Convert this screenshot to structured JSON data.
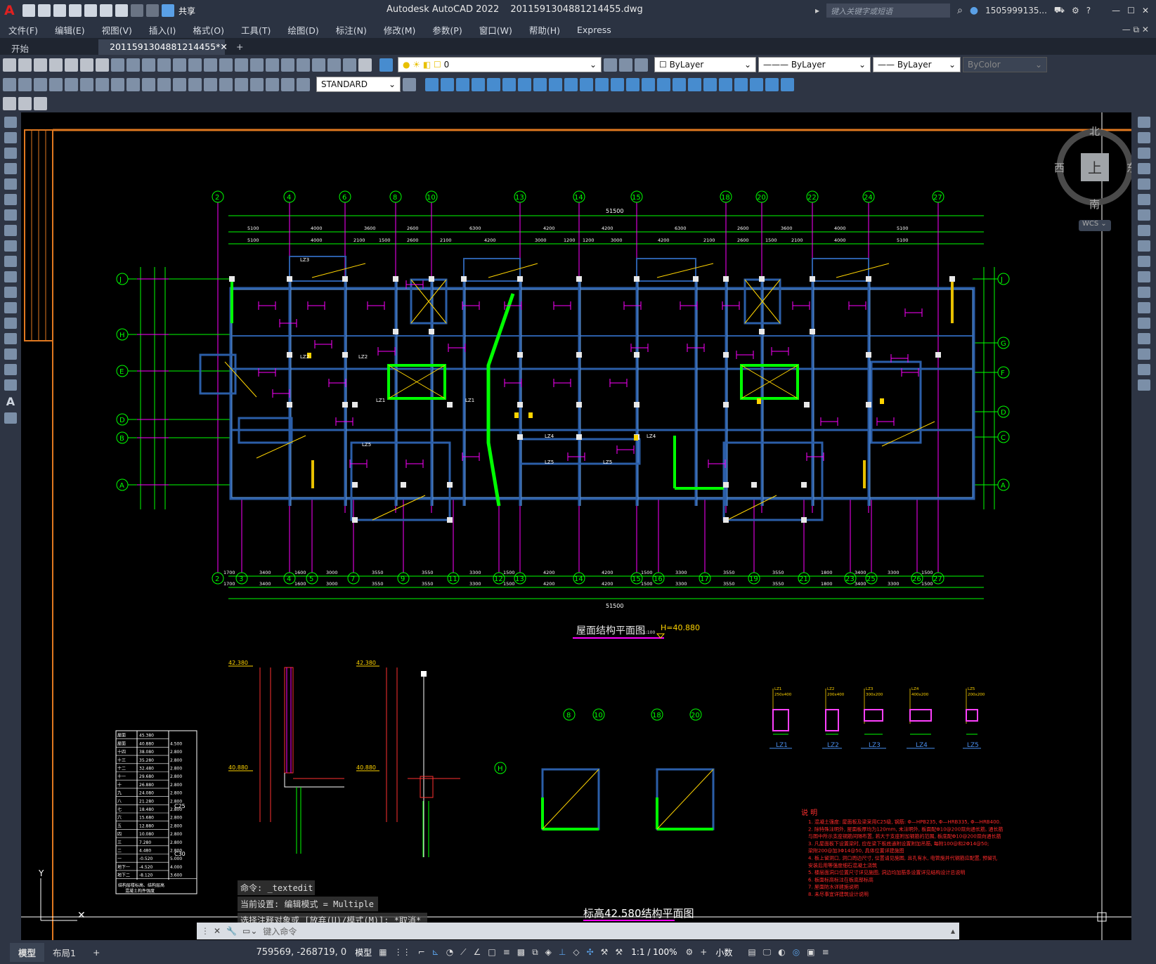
{
  "titlebar": {
    "app": "Autodesk AutoCAD 2022",
    "file": "2011591304881214455.dwg",
    "share": "共享",
    "search_placeholder": "键入关键字或短语",
    "user": "1505999135..."
  },
  "menu": [
    "文件(F)",
    "编辑(E)",
    "视图(V)",
    "插入(I)",
    "格式(O)",
    "工具(T)",
    "绘图(D)",
    "标注(N)",
    "修改(M)",
    "参数(P)",
    "窗口(W)",
    "帮助(H)",
    "Express"
  ],
  "tabs": {
    "start": "开始",
    "doc": "2011591304881214455*"
  },
  "toolbar": {
    "layer": "0",
    "color": "ByLayer",
    "linetype": "ByLayer",
    "lineweight": "ByLayer",
    "plotstyle": "ByColor",
    "textstyle": "STANDARD"
  },
  "navcube": {
    "north": "北",
    "south": "南",
    "east": "东",
    "west": "西",
    "top": "上",
    "wcs": "WCS"
  },
  "drawing": {
    "main_title": "屋面结构平面图",
    "main_scale": "1:100",
    "main_elev": "H=40.880",
    "sub_title": "标高42.580结构平面图",
    "total_dim": "51500",
    "top_axes": [
      "2",
      "4",
      "6",
      "8",
      "10",
      "13",
      "14",
      "15",
      "18",
      "20",
      "22",
      "24",
      "27"
    ],
    "bottom_axes": [
      "2",
      "3",
      "4",
      "5",
      "7",
      "9",
      "11",
      "12",
      "13",
      "14",
      "15",
      "16",
      "17",
      "19",
      "21",
      "23",
      "25",
      "26",
      "27"
    ],
    "left_axes": [
      "J",
      "H",
      "E",
      "D",
      "B",
      "A"
    ],
    "right_axes": [
      "J",
      "G",
      "F",
      "D",
      "C",
      "A"
    ],
    "top_dims": [
      "5100",
      "4000",
      "3600",
      "2600",
      "6300",
      "4200",
      "4200",
      "6300",
      "2600",
      "3600",
      "4000",
      "5100"
    ],
    "top_dims2": [
      "5100",
      "4000",
      "2100",
      "1500",
      "2600",
      "2100",
      "4200",
      "3000",
      "1200",
      "1200",
      "3000",
      "4200",
      "2100",
      "2600",
      "1500",
      "2100",
      "4000",
      "5100"
    ],
    "bottom_dims": [
      "1700",
      "3400",
      "1600",
      "3000",
      "3550",
      "3550",
      "3300",
      "1500",
      "4200",
      "4200",
      "1500",
      "3300",
      "3550",
      "3550",
      "1800",
      "3400",
      "3300",
      "1500"
    ],
    "col_labels": [
      "LZ1",
      "LZ2",
      "LZ3",
      "LZ4",
      "LZ5"
    ],
    "col_sizes": [
      "250x400",
      "200x400",
      "300x200",
      "400x200",
      "200x200"
    ],
    "elev1": "42.380",
    "elev2": "40.880",
    "notes_title": "说 明",
    "notes": [
      "1. 混凝土强度: 屋面板及梁采用C25级, 钢筋: Φ—HPB235, Φ—HRB335, Φ—HRB400.",
      "2. 除特殊注明外, 屋面板厚均为120mm, 未注明外, 板面配Φ10@200双向通长筋, 通长筋",
      "   与图中所示支座钢筋间隔布置, 若大于支座附加钢筋的范围, 板底配Φ10@200双向通长筋",
      "3. 凡屋面板下设置梁时, 应在梁下板底通附设置附加吊筋, 每附100@和2Φ14@50;",
      "   梁附200@加3Φ14@50, 具体位置详建施图",
      "4. 板上留洞口, 洞口周边尺寸, 位置请见施图, 且孔有水, 电管施并代钢筋应配置, 预留孔",
      "   安装后用等强度细石混凝土浇筑",
      "5. 楼层面洞口位置尺寸详见施图, 洞边均加筋条设置详见结构设计总说明",
      "6. 板面标高标注在板底部标高",
      "7. 屋面防水详建施说明",
      "8. 未尽事宜详建筑设计说明"
    ],
    "table_title": "结构层楼标高、结构层高",
    "table_sub": "混凝土构件强度",
    "table_rows": [
      [
        "屋面",
        "45.380",
        ""
      ],
      [
        "屋面",
        "40.880",
        "4.500"
      ],
      [
        "十四",
        "38.080",
        "2.800"
      ],
      [
        "十三",
        "35.280",
        "2.800"
      ],
      [
        "十二",
        "32.480",
        "2.800"
      ],
      [
        "十一",
        "29.680",
        "2.800"
      ],
      [
        "十",
        "26.880",
        "2.800"
      ],
      [
        "九",
        "24.080",
        "2.800"
      ],
      [
        "八",
        "21.280",
        "2.800"
      ],
      [
        "七",
        "18.480",
        "2.800"
      ],
      [
        "六",
        "15.680",
        "2.800"
      ],
      [
        "五",
        "12.880",
        "2.800"
      ],
      [
        "四",
        "10.080",
        "2.800"
      ],
      [
        "三",
        "7.280",
        "2.800"
      ],
      [
        "二",
        "4.480",
        "2.800"
      ],
      [
        "一",
        "-0.520",
        "5.000"
      ],
      [
        "地下一",
        "-4.520",
        "4.000"
      ],
      [
        "地下二",
        "-8.120",
        "3.600"
      ]
    ],
    "table_grade1": "C25",
    "table_grade2": "C30"
  },
  "command": {
    "line1": "命令: _textedit",
    "line2": "当前设置: 编辑模式 = Multiple",
    "line3": "选择注释对象或 [放弃(U)/模式(M)]: *取消*",
    "input_placeholder": "键入命令"
  },
  "status": {
    "model_tab": "模型",
    "layout_tab": "布局1",
    "coords": "759569, -268719, 0",
    "space": "模型",
    "scale": "1:1 / 100%",
    "units": "小数"
  }
}
